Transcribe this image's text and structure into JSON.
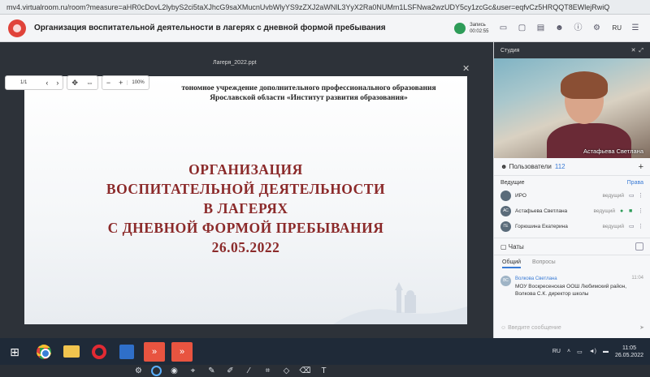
{
  "browser": {
    "url": "mv4.virtualroom.ru/room?measure=aHR0cDovL2lybyS2ci5taXJhcG9saXMucnUvbWlyYS9zZXJ2aWNlL3YyX2Ra0NUMm1LSFNwa2wzUDY5cy1zcGc&user=eqfvCz5HRQQT8EWlejRwiQ"
  },
  "header": {
    "title": "Организация воспитательной деятельности в лагерях с дневной формой пребывания",
    "recording_label": "Запись",
    "recording_time": "00:02:55",
    "lang": "RU"
  },
  "presentation": {
    "filename": "Лагеря_2022.ppt",
    "page": "1/1",
    "zoom": "100%",
    "institution_line1": "тономное учреждение дополнительного профессионального образования",
    "institution_line2": "Ярославской области «Институт развития образования»",
    "title_lines": [
      "ОРГАНИЗАЦИЯ",
      "ВОСПИТАТЕЛЬНОЙ ДЕЯТЕЛЬНОСТИ",
      "В ЛАГЕРЯХ",
      "С ДНЕВНОЙ ФОРМОЙ ПРЕБЫВАНИЯ",
      "26.05.2022"
    ]
  },
  "video": {
    "header": "Студия",
    "name": "Астафьева Светлана"
  },
  "users": {
    "title": "Пользователи",
    "count": "112",
    "section": "Ведущие",
    "rights": "Права",
    "rows": [
      {
        "initials": "",
        "name": "ИРО",
        "role": "ведущий"
      },
      {
        "initials": "АС",
        "name": "Астафьева Светлана",
        "role": "ведущий"
      },
      {
        "initials": "ГЕ",
        "name": "Горюшина Екатерина",
        "role": "ведущий"
      }
    ]
  },
  "chat": {
    "title": "Чаты",
    "tabs": [
      "Общий",
      "Вопросы"
    ],
    "message": {
      "initials": "ВС",
      "author": "Волкова Светлана",
      "time": "11:04",
      "text": "МОУ Воскресенская ООШ Любимский район, Волкова С.К. директор школы"
    },
    "input_placeholder": "Введите сообщение"
  },
  "taskbar": {
    "lang": "RU",
    "time": "11:05",
    "date": "26.05.2022"
  }
}
